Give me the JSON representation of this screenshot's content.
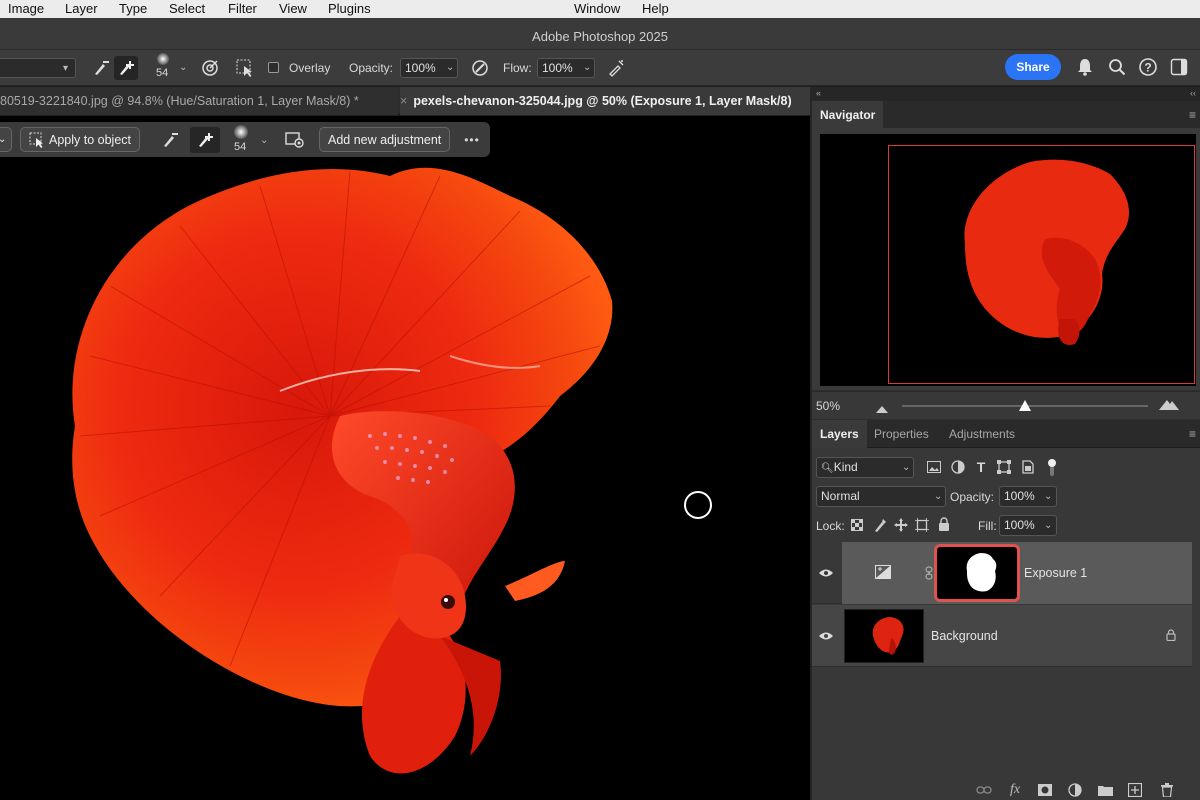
{
  "menubar": {
    "items": [
      "Image",
      "Layer",
      "Type",
      "Select",
      "Filter",
      "View",
      "Plugins",
      "Window",
      "Help"
    ]
  },
  "window": {
    "title": "Adobe Photoshop 2025"
  },
  "options_bar": {
    "brush_size": "54",
    "overlay_label": "Overlay",
    "opacity_label": "Opacity:",
    "opacity_value": "100%",
    "flow_label": "Flow:",
    "flow_value": "100%",
    "share_label": "Share"
  },
  "doc_tabs": [
    {
      "label": "80519-3221840.jpg @ 94.8% (Hue/Saturation 1, Layer Mask/8) *",
      "active": false
    },
    {
      "label": "pexels-chevanon-325044.jpg @ 50% (Exposure 1, Layer Mask/8)",
      "active": true
    }
  ],
  "taskbar": {
    "apply_label": "Apply to object",
    "brush_size": "54",
    "add_adjustment_label": "Add new adjustment",
    "more_label": "•••"
  },
  "navigator": {
    "tab_label": "Navigator",
    "zoom_value": "50%",
    "zoom_slider_fraction": 0.5
  },
  "layers_panel": {
    "tabs": [
      "Layers",
      "Properties",
      "Adjustments"
    ],
    "filter_kind": "Kind",
    "blend_mode": "Normal",
    "opacity_label": "Opacity:",
    "opacity_value": "100%",
    "lock_label": "Lock:",
    "fill_label": "Fill:",
    "fill_value": "100%",
    "layers": [
      {
        "name": "Exposure 1",
        "selected": true
      },
      {
        "name": "Background",
        "selected": false,
        "locked": true
      }
    ]
  },
  "colors": {
    "accent_blue": "#2a74f5",
    "mask_highlight": "#e0524d",
    "fish_red": "#e8220f"
  }
}
